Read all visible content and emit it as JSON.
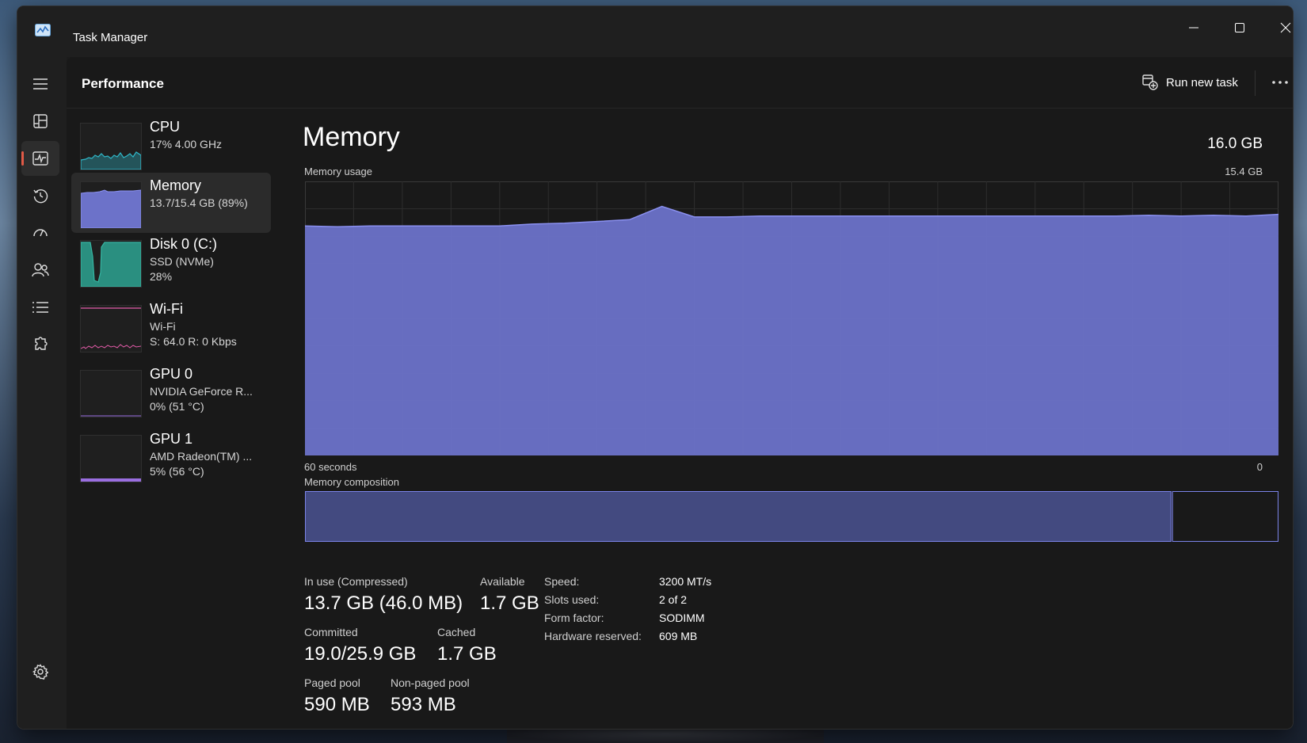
{
  "window": {
    "title": "Task Manager"
  },
  "header": {
    "page_title": "Performance",
    "run_new_task": "Run new task"
  },
  "perf_list": [
    {
      "name": "CPU",
      "lines": [
        "17%  4.00 GHz"
      ],
      "color": "#2fb8c9",
      "icon": "cpu-graph"
    },
    {
      "name": "Memory",
      "lines": [
        "13.7/15.4 GB (89%)"
      ],
      "color": "#7b83e8",
      "icon": "memory-graph"
    },
    {
      "name": "Disk 0 (C:)",
      "lines": [
        "SSD (NVMe)",
        "28%"
      ],
      "color": "#36b5a2",
      "icon": "disk-graph"
    },
    {
      "name": "Wi-Fi",
      "lines": [
        "Wi-Fi",
        "S: 64.0  R: 0 Kbps"
      ],
      "color": "#e05aa6",
      "icon": "network-graph"
    },
    {
      "name": "GPU 0",
      "lines": [
        "NVIDIA GeForce R...",
        "0%  (51 °C)"
      ],
      "color": "#9a6ee0",
      "icon": "gpu-graph"
    },
    {
      "name": "GPU 1",
      "lines": [
        "AMD Radeon(TM) ...",
        "5%  (56 °C)"
      ],
      "color": "#9a6ee0",
      "icon": "gpu-graph"
    }
  ],
  "memory": {
    "title": "Memory",
    "total": "16.0 GB",
    "usage_label": "Memory usage",
    "usage_max": "15.4 GB",
    "x_left": "60 seconds",
    "x_right": "0",
    "composition_label": "Memory composition",
    "composition": {
      "in_use_fraction": 0.89,
      "available_fraction": 0.11
    },
    "stats": {
      "in_use_label": "In use (Compressed)",
      "in_use": "13.7 GB (46.0 MB)",
      "available_label": "Available",
      "available": "1.7 GB",
      "committed_label": "Committed",
      "committed": "19.0/25.9 GB",
      "cached_label": "Cached",
      "cached": "1.7 GB",
      "paged_label": "Paged pool",
      "paged": "590 MB",
      "nonpaged_label": "Non-paged pool",
      "nonpaged": "593 MB"
    },
    "specs": [
      {
        "key": "Speed:",
        "value": "3200 MT/s"
      },
      {
        "key": "Slots used:",
        "value": "2 of 2"
      },
      {
        "key": "Form factor:",
        "value": "SODIMM"
      },
      {
        "key": "Hardware reserved:",
        "value": "609 MB"
      }
    ]
  },
  "chart_data": {
    "type": "area",
    "xlabel": "60 seconds",
    "ylabel": "Memory usage",
    "ylim": [
      0,
      15.4
    ],
    "x": [
      60,
      58,
      56,
      54,
      52,
      50,
      48,
      46,
      44,
      42,
      40,
      38,
      36,
      34,
      32,
      30,
      28,
      26,
      24,
      22,
      20,
      18,
      16,
      14,
      12,
      10,
      8,
      6,
      4,
      2,
      0
    ],
    "series": [
      {
        "values": [
          12.9,
          12.85,
          12.9,
          12.9,
          12.9,
          12.9,
          12.9,
          13.0,
          13.05,
          13.15,
          13.25,
          14.0,
          13.4,
          13.4,
          13.45,
          13.45,
          13.45,
          13.45,
          13.45,
          13.45,
          13.45,
          13.45,
          13.45,
          13.45,
          13.45,
          13.45,
          13.5,
          13.45,
          13.5,
          13.45,
          13.55
        ]
      }
    ],
    "grid": true,
    "color": "#6c72c9"
  }
}
